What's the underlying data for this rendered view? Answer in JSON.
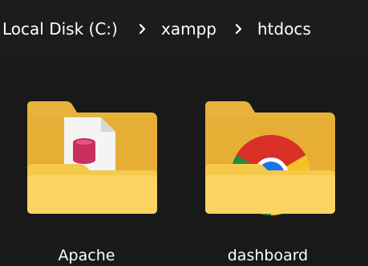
{
  "breadcrumb": {
    "items": [
      {
        "label": "Local Disk (C:)"
      },
      {
        "label": "xampp"
      },
      {
        "label": "htdocs"
      }
    ]
  },
  "folders": [
    {
      "name": "Apache",
      "icon": "folder-with-document-icon"
    },
    {
      "name": "dashboard",
      "icon": "folder-with-chrome-icon"
    }
  ],
  "colors": {
    "background": "#191919",
    "folder_back": "#E9B23D",
    "folder_front": "#FBD462",
    "chrome_red": "#D93025",
    "chrome_yellow": "#F7C324",
    "chrome_green": "#1E8E3E",
    "chrome_blue": "#1A73E8"
  }
}
